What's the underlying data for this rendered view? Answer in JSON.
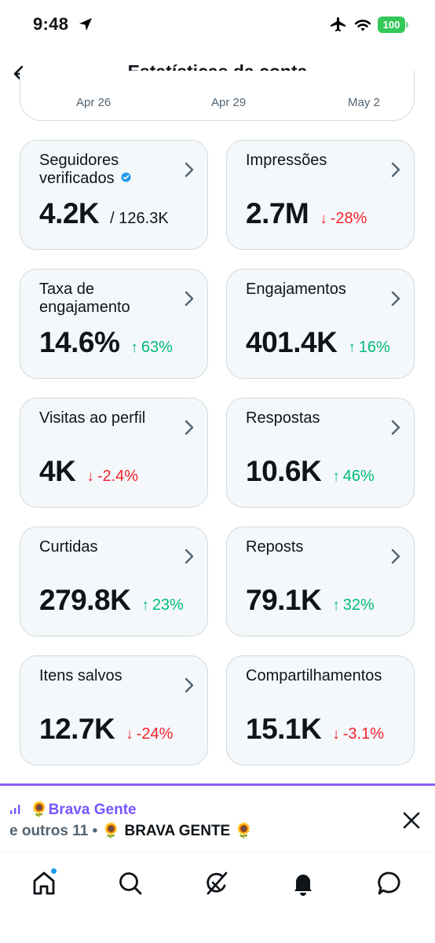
{
  "status_bar": {
    "time": "9:48",
    "battery": "100",
    "icons": [
      "location-arrow-icon",
      "airplane-icon",
      "wifi-icon",
      "battery-icon"
    ]
  },
  "header": {
    "title": "Estatísticas da conta",
    "back_icon": "arrow-left-icon"
  },
  "chart": {
    "x_labels": [
      "Apr 26",
      "Apr 29",
      "May 2"
    ]
  },
  "cards": [
    {
      "label": "Seguidores verificados",
      "value": "4.2K",
      "total": "/ 126.3K",
      "verified": true,
      "chevron": true
    },
    {
      "label": "Impressões",
      "value": "2.7M",
      "delta": "-28%",
      "direction": "down",
      "chevron": true
    },
    {
      "label": "Taxa de engajamento",
      "value": "14.6%",
      "delta": "63%",
      "direction": "up",
      "chevron": true
    },
    {
      "label": "Engajamentos",
      "value": "401.4K",
      "delta": "16%",
      "direction": "up",
      "chevron": true
    },
    {
      "label": "Visitas ao perfil",
      "value": "4K",
      "delta": "-2.4%",
      "direction": "down",
      "chevron": true
    },
    {
      "label": "Respostas",
      "value": "10.6K",
      "delta": "46%",
      "direction": "up",
      "chevron": true
    },
    {
      "label": "Curtidas",
      "value": "279.8K",
      "delta": "23%",
      "direction": "up",
      "chevron": true
    },
    {
      "label": "Reposts",
      "value": "79.1K",
      "delta": "32%",
      "direction": "up",
      "chevron": true
    },
    {
      "label": "Itens salvos",
      "value": "12.7K",
      "delta": "-24%",
      "direction": "down",
      "chevron": true
    },
    {
      "label": "Compartilhamentos",
      "value": "15.1K",
      "delta": "-3.1%",
      "direction": "down",
      "chevron": false
    }
  ],
  "spaces": {
    "title": "🌻Brava Gente",
    "subtitle_prefix": "e outros 11 • ",
    "subtitle_name": "🌻 BRAVA GENTE 🌻"
  },
  "colors": {
    "up": "#00ba7c",
    "down": "#f4212e",
    "spaces_accent": "#7856ff",
    "verified": "#1d9bf0"
  },
  "bottom_nav": [
    "home-icon",
    "search-icon",
    "grok-icon",
    "notifications-icon",
    "messages-icon"
  ]
}
